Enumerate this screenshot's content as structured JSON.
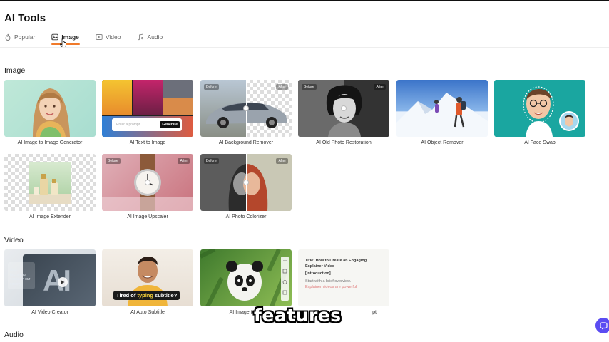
{
  "page": {
    "title": "AI Tools"
  },
  "tabs": [
    {
      "label": "Popular",
      "icon": "flame-icon",
      "active": false
    },
    {
      "label": "Image",
      "icon": "image-icon",
      "active": true
    },
    {
      "label": "Video",
      "icon": "video-icon",
      "active": false
    },
    {
      "label": "Audio",
      "icon": "music-note-icon",
      "active": false
    }
  ],
  "sections": {
    "image": {
      "title": "Image"
    },
    "video": {
      "title": "Video"
    },
    "audio": {
      "title": "Audio"
    }
  },
  "image_tools": [
    {
      "label": "AI Image to Image Generator"
    },
    {
      "label": "AI Text to Image",
      "prompt_placeholder": "Enter a prompt...",
      "generate_label": "Generate"
    },
    {
      "label": "AI Background Remover",
      "before": "Before",
      "after": "After"
    },
    {
      "label": "AI Old Photo Restoration",
      "before": "Before",
      "after": "After"
    },
    {
      "label": "AI Object Remover"
    },
    {
      "label": "AI Face Swap"
    },
    {
      "label": "AI Image Extender"
    },
    {
      "label": "AI Image Upscaler",
      "before": "Before",
      "after": "After"
    },
    {
      "label": "AI Photo Colorizer",
      "before": "Before",
      "after": "After"
    }
  ],
  "video_tools": [
    {
      "label": "AI Video Creator",
      "thumb_text": "AI is becoming crucial in our society.",
      "thumb_big": "AI"
    },
    {
      "label": "AI Auto Subtitle",
      "caption_prefix": "Tired of ",
      "caption_highlight": "typing",
      "caption_suffix": " subtitle?"
    },
    {
      "label": "AI Image to 3D"
    },
    {
      "label": "pt",
      "doc_title": "Title: How to Create an Engaging Explainer Video",
      "doc_section": "[Introduction]",
      "doc_line1": "Start with a brief overview.",
      "doc_line2": "Explainer videos are powerful"
    }
  ],
  "overlay": {
    "subtitle": "features"
  },
  "colors": {
    "accent": "#f07a2a",
    "chat": "#5b4cf2"
  }
}
